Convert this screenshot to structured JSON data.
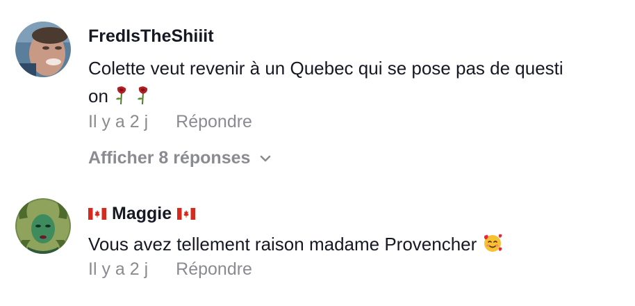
{
  "comments": [
    {
      "username": "FredIsTheShiiit",
      "text_line1": "Colette veut revenir à un Quebec qui se pose pas de questi",
      "text_line2": "on",
      "text_emoji": "wilted-rose-emoji",
      "time": "Il y a 2 j",
      "reply": "Répondre",
      "view_replies": "Afficher 8 réponses"
    },
    {
      "username": "Maggie",
      "text": "Vous avez tellement raison madame Provencher",
      "text_emoji": "smiling-face-with-hearts-emoji",
      "time": "Il y a 2 j",
      "reply": "Répondre"
    }
  ],
  "colors": {
    "text": "#161823",
    "muted": "#8a8b91",
    "flag_red": "#d52b1e"
  }
}
